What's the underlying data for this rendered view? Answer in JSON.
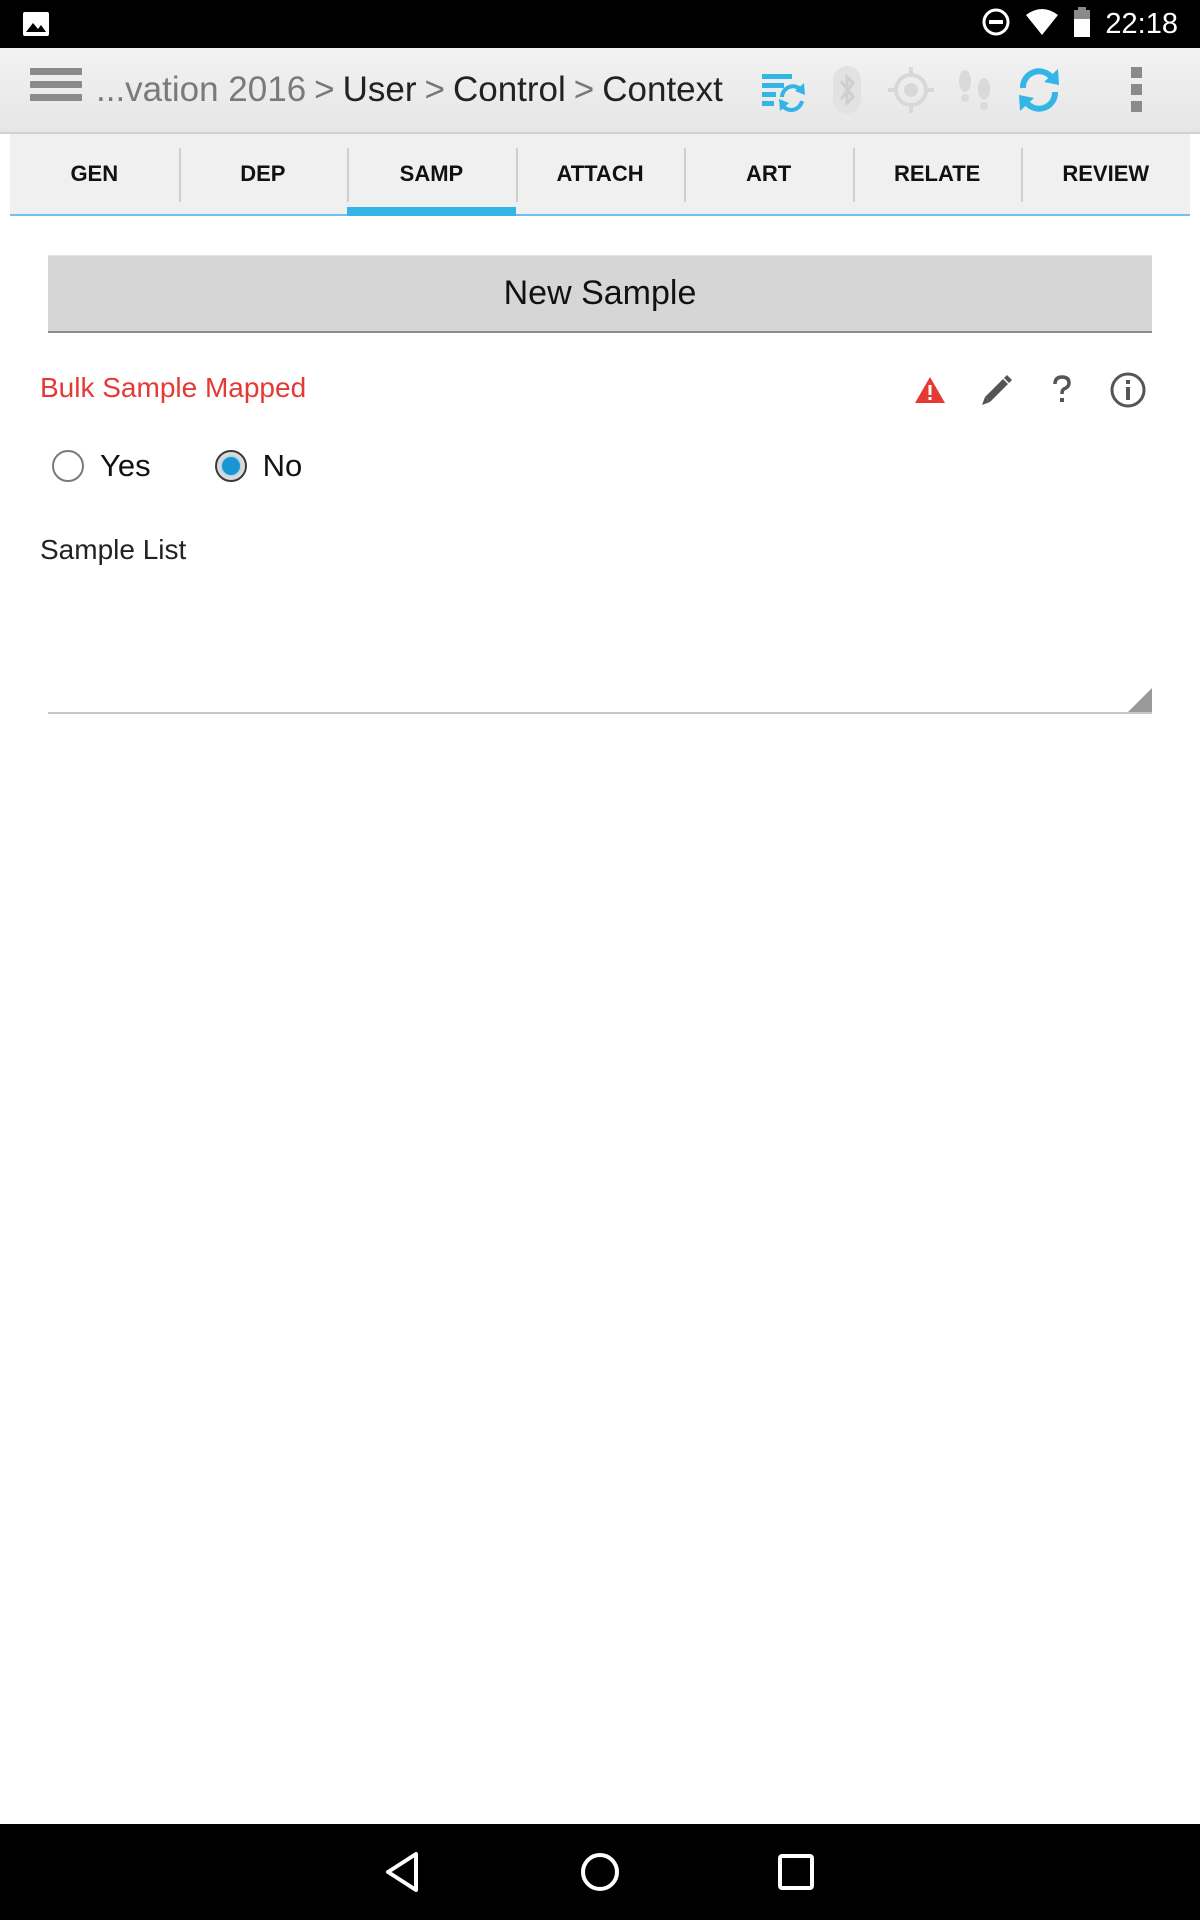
{
  "status_bar": {
    "time": "22:18",
    "icons": [
      "image-notification-icon",
      "do-not-disturb-icon",
      "wifi-icon",
      "battery-icon"
    ]
  },
  "action_bar": {
    "breadcrumb_prefix": "...vation 2016",
    "breadcrumb": [
      "User",
      "Control",
      "Context"
    ],
    "separator": ">",
    "icons": [
      "menu-icon",
      "sync-data-icon",
      "bluetooth-icon",
      "gps-icon",
      "footprints-icon",
      "refresh-icon",
      "overflow-menu-icon"
    ],
    "accent_color": "#33b5e5"
  },
  "tabs": [
    {
      "label": "GEN",
      "active": false
    },
    {
      "label": "DEP",
      "active": false
    },
    {
      "label": "SAMP",
      "active": true
    },
    {
      "label": "ATTACH",
      "active": false
    },
    {
      "label": "ART",
      "active": false
    },
    {
      "label": "RELATE",
      "active": false
    },
    {
      "label": "REVIEW",
      "active": false
    }
  ],
  "form": {
    "new_sample_label": "New Sample",
    "bulk_label": "Bulk Sample Mapped",
    "bulk_label_color": "#e53935",
    "field_tools": [
      "warning-icon",
      "edit-icon",
      "help-icon",
      "info-icon"
    ],
    "radio_options": [
      {
        "label": "Yes",
        "checked": false
      },
      {
        "label": "No",
        "checked": true
      }
    ],
    "sample_list_label": "Sample List",
    "sample_list_value": ""
  },
  "nav_bar": {
    "buttons": [
      "back-icon",
      "home-icon",
      "recents-icon"
    ]
  }
}
